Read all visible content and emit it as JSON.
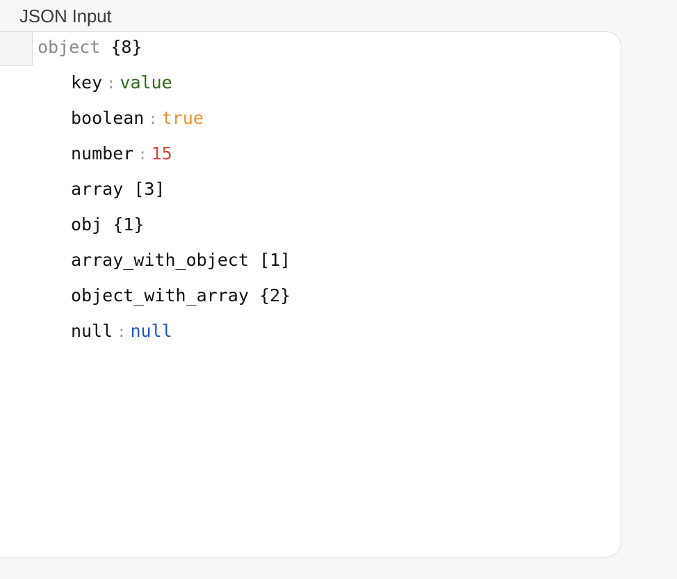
{
  "field": {
    "label": "JSON Input"
  },
  "root": {
    "type": "object",
    "count": "{8}"
  },
  "entries": [
    {
      "key": "key",
      "value": "value",
      "kind": "string"
    },
    {
      "key": "boolean",
      "value": "true",
      "kind": "boolean"
    },
    {
      "key": "number",
      "value": "15",
      "kind": "number"
    },
    {
      "key": "array",
      "count": "[3]",
      "kind": "array"
    },
    {
      "key": "obj",
      "count": "{1}",
      "kind": "object"
    },
    {
      "key": "array_with_object",
      "count": "[1]",
      "kind": "array"
    },
    {
      "key": "object_with_array",
      "count": "{2}",
      "kind": "object"
    },
    {
      "key": "null",
      "value": "null",
      "kind": "null"
    }
  ],
  "colors": {
    "string": "#2b6a16",
    "boolean": "#f0922b",
    "number": "#d64a36",
    "null": "#1f55c8"
  }
}
